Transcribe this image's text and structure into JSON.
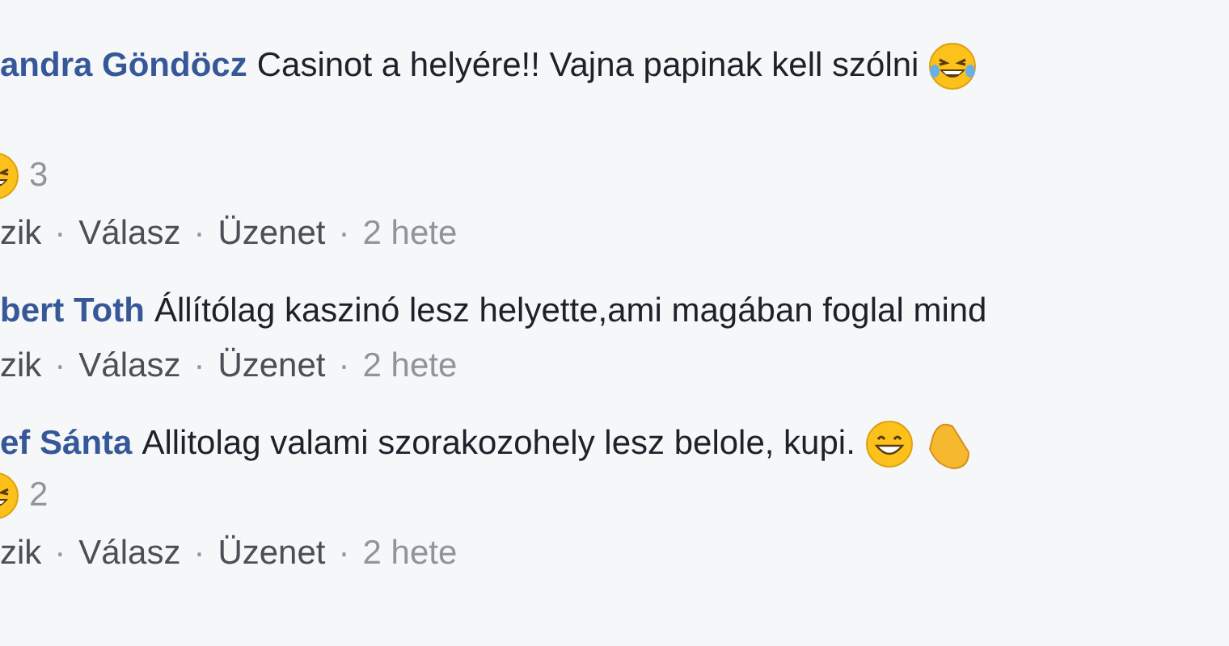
{
  "comments": [
    {
      "author": "andra Göndöcz",
      "text": "Casinot a helyére!! Vajna papinak kell szólni",
      "emojis": [
        {
          "kind": "tears"
        }
      ],
      "reactions": {
        "kind": "laugh",
        "count": "3"
      },
      "actions": [
        {
          "label": "zik"
        },
        {
          "separator": "·",
          "label": "Válasz"
        },
        {
          "separator": "·",
          "label": "Üzenet"
        }
      ],
      "time_separator": "·",
      "time": "2 hete"
    },
    {
      "author": "bert Toth",
      "text": "Állítólag kaszinó lesz helyette,ami magában foglal mind",
      "actions": [
        {
          "label": "zik"
        },
        {
          "separator": "·",
          "label": "Válasz"
        },
        {
          "separator": "·",
          "label": "Üzenet"
        }
      ],
      "time_separator": "·",
      "time": "2 hete"
    },
    {
      "author": "ef Sánta",
      "text": "Allitolag valami szorakozohely lesz belole, kupi.",
      "emojis": [
        {
          "kind": "grin"
        },
        {
          "kind": "clap"
        }
      ],
      "reactions": {
        "kind": "laugh",
        "count": "2"
      },
      "actions": [
        {
          "label": "zik"
        },
        {
          "separator": "·",
          "label": "Válasz"
        },
        {
          "separator": "·",
          "label": "Üzenet"
        }
      ],
      "time_separator": "·",
      "time": "2 hete"
    }
  ]
}
